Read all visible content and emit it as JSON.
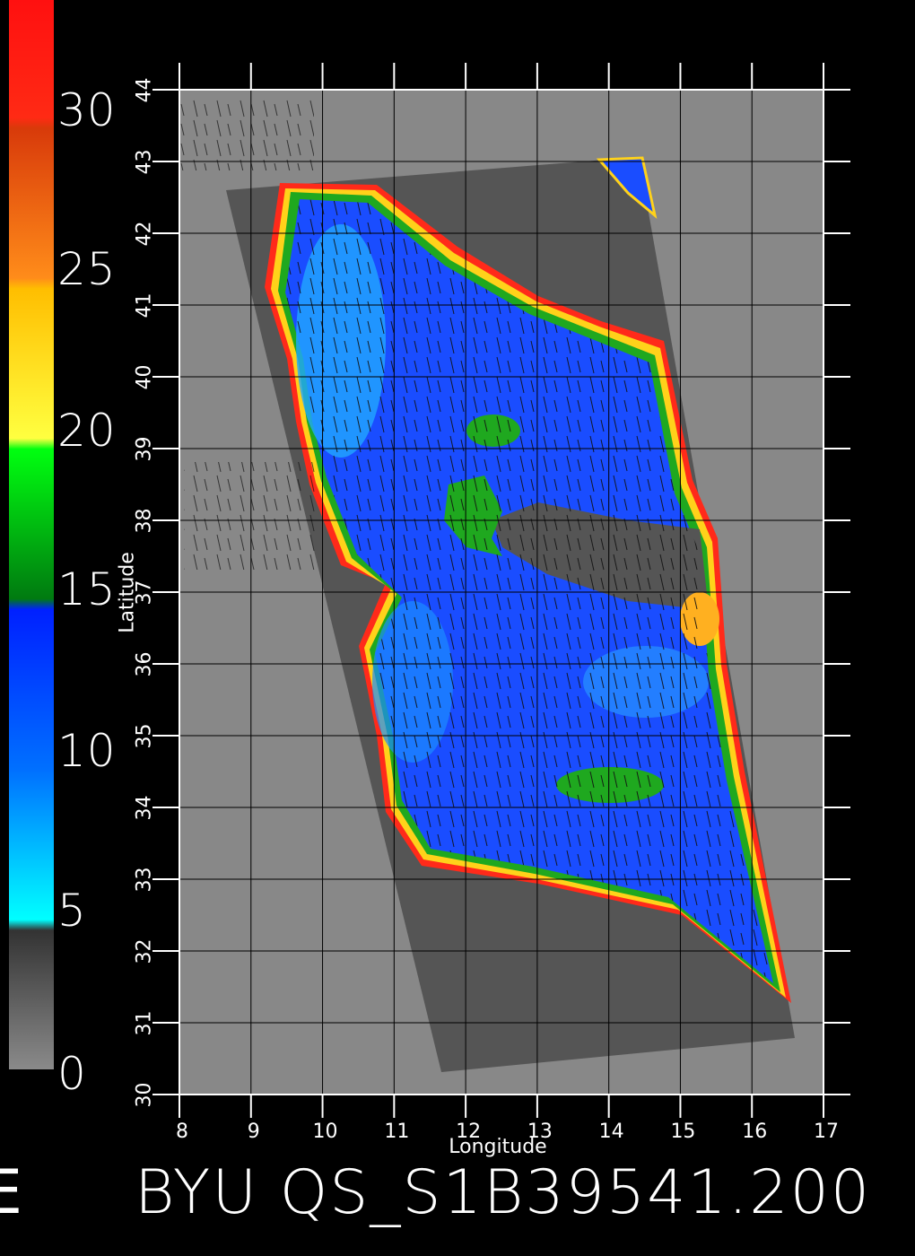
{
  "colorbar": {
    "labels": [
      "30",
      "25",
      "20",
      "15",
      "10",
      "5",
      "0"
    ],
    "stops": [
      "#ff1010",
      "#e0340a",
      "#ff8c1a",
      "#ffc400",
      "#ffff40",
      "#00ff10",
      "#007a10",
      "#0020ff",
      "#00aaff",
      "#00ffff",
      "#3a3a3a",
      "#8a8a8a"
    ]
  },
  "axes": {
    "xlabel": "Longitude",
    "ylabel": "Latitude",
    "lon_ticks": [
      "8",
      "9",
      "10",
      "11",
      "12",
      "13",
      "14",
      "15",
      "16",
      "17"
    ],
    "lat_ticks": [
      "30",
      "31",
      "32",
      "33",
      "34",
      "35",
      "36",
      "37",
      "38",
      "39",
      "40",
      "41",
      "42",
      "43",
      "44"
    ],
    "lon_range": [
      8,
      17
    ],
    "lat_range": [
      30,
      44
    ]
  },
  "footer": {
    "title": "BYU QS_S1B39541.200",
    "edge_char": "E"
  },
  "colors": {
    "background": "#000000",
    "land": "#888888",
    "swath_nodata": "#555555",
    "sea_high": "#1a4dff",
    "sea_low": "#22ccff",
    "coast_green": "#1fa81f",
    "coast_yellow": "#ffd21a",
    "coast_red": "#ff2a1a"
  }
}
